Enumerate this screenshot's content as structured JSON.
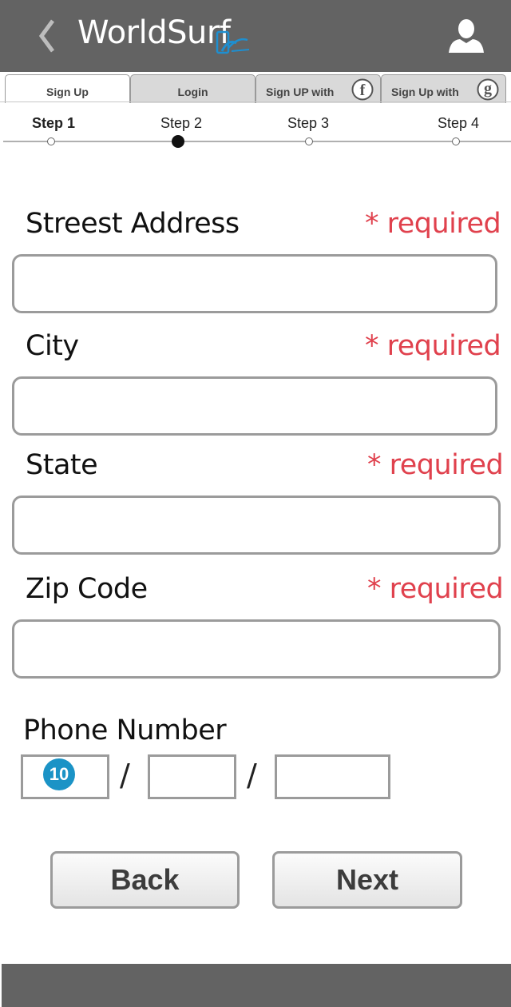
{
  "header": {
    "title": "WorldSurf",
    "back_icon": "chevron-left-icon",
    "logo_icon": "device-wave-logo-icon",
    "user_icon": "user-profile-icon"
  },
  "tabs": [
    {
      "label": "Sign Up",
      "active": true
    },
    {
      "label": "Login",
      "active": false
    },
    {
      "label": "Sign UP with",
      "icon": "facebook-icon",
      "glyph": "f"
    },
    {
      "label": "Sign Up with",
      "icon": "google-icon",
      "glyph": "g"
    }
  ],
  "steps": {
    "items": [
      "Step 1",
      "Step 2",
      "Step 3",
      "Step 4"
    ],
    "current_index": 1
  },
  "form": {
    "required_text": "* required",
    "fields": [
      {
        "label": "Streest Address",
        "value": ""
      },
      {
        "label": "City",
        "value": ""
      },
      {
        "label": "State",
        "value": ""
      },
      {
        "label": "Zip Code",
        "value": ""
      }
    ],
    "phone": {
      "label": "Phone Number",
      "separator": "/",
      "badge": "10"
    }
  },
  "buttons": {
    "back": "Back",
    "next": "Next"
  },
  "colors": {
    "header": "#636363",
    "required": "#e0414d",
    "badge": "#1b93c6",
    "logo_accent": "#1e8fd0"
  }
}
